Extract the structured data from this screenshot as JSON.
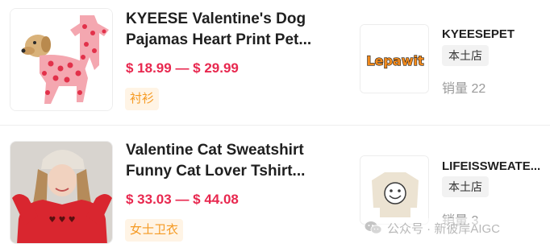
{
  "products": [
    {
      "title_line1": "KYEESE Valentine's Dog",
      "title_line2": "Pajamas Heart Print Pet...",
      "price": "$ 18.99 — $ 29.99",
      "tag": "衬衫",
      "image_icon": "dog-pajamas-photo",
      "shop": {
        "logo_text": "Lepawit",
        "name": "KYEESEPET",
        "badge": "本土店",
        "sales": "销量 22"
      }
    },
    {
      "title_line1": "Valentine Cat Sweatshirt",
      "title_line2": "Funny Cat Lover Tshirt...",
      "price": "$ 33.03 — $ 44.08",
      "tag": "女士卫衣",
      "image_icon": "woman-sweatshirt-photo",
      "shop": {
        "logo_text": "",
        "name": "LIFEISSWEATE...",
        "badge": "本土店",
        "sales": "销量 3"
      }
    }
  ],
  "watermark": {
    "text": "公众号 · 新彼岸AIGC",
    "icon": "wechat-icon"
  },
  "colors": {
    "price": "#e8284f",
    "tag_text": "#f59a23",
    "tag_bg": "#fff4e5",
    "logo_orange": "#f28a1c"
  }
}
